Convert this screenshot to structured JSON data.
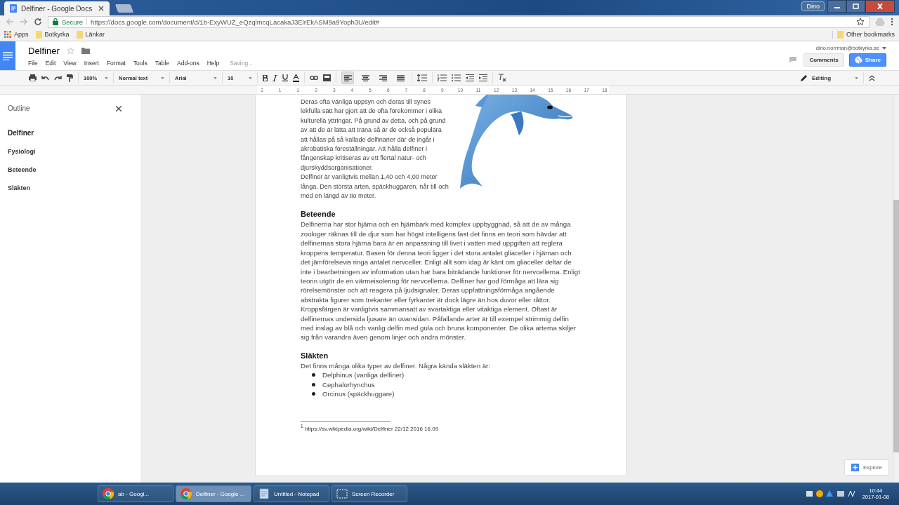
{
  "browser": {
    "tab_title": "Delfiner - Google Docs",
    "secure_label": "Secure",
    "url": "https://docs.google.com/document/d/1b-ExyWUZ_eQzqlmcqLacakaJ3ElrEkASM9a9Yoph3U/edit#",
    "bookmarks": [
      "Apps",
      "Botkyrka",
      "Länkar"
    ],
    "other_bookmarks": "Other bookmarks",
    "user_badge": "Dino"
  },
  "docs": {
    "title": "Delfiner",
    "menu": [
      "File",
      "Edit",
      "View",
      "Insert",
      "Format",
      "Tools",
      "Table",
      "Add-ons",
      "Help"
    ],
    "status": "Saving...",
    "account": "dino.norrman@botkyrka.se",
    "comments_button": "Comments",
    "share_button": "Share"
  },
  "toolbar": {
    "zoom": "100%",
    "style": "Normal text",
    "font": "Arial",
    "size": "10",
    "alignment": [
      {
        "selected": true
      },
      {
        "selected": false
      },
      {
        "selected": false
      },
      {
        "selected": false
      }
    ],
    "mode": "Editing"
  },
  "ruler": [
    "2",
    "1",
    "1",
    "2",
    "3",
    "4",
    "5",
    "6",
    "7",
    "8",
    "9",
    "10",
    "11",
    "12",
    "13",
    "14",
    "15",
    "16",
    "17",
    "18"
  ],
  "outline": {
    "title": "Outline",
    "items": [
      "Delfiner",
      "Fysiologi",
      "Beteende",
      "Släkten"
    ]
  },
  "document": {
    "intro": [
      "Deras ofta vänliga uppsyn och deras till synes lekfulla sätt har gjort att de ofta förekommer i olika kulturella yttringar. På grund av detta, och på grund av att de är lätta att träna så är de också populära att hållas på så kallade delfinarier där de ingår i akrobatiska föreställningar. Att hålla delfiner i fångenskap kritiseras av ett flertal natur- och djurskyddsorganisationer.",
      "Delfiner är vanligtvis mellan 1,40 och 4,00 meter långa. Den största arten, späckhuggaren, når till och med en längd av tio meter."
    ],
    "sections": [
      {
        "heading": "Beteende",
        "text": "Delfinerna har stor hjärna och en hjärnbark med komplex uppbyggnad, så att de av många zoologer räknas till de djur som har högst intelligens fast det finns en teori som hävdar att delfinernas stora hjärna bara är en anpassning till livet i vatten med uppgiften att reglera kroppens temperatur. Basen för denna teori ligger i det stora antalet gliaceller i hjärnan och det jämförelsevis ringa antalet nervceller. Enligt allt som idag är känt om gliaceller deltar de inte i bearbetningen av information utan har bara biträdande funktioner för nervcellerna. Enligt teorin utgör de en värmeisolering för nervcellerna. Delfiner har god förmåga att lära sig rörelsemönster och att reagera på ljudsignaler. Deras uppfattningsförmåga angående abstrakta figurer som trekanter eller fyrkanter är dock lägre än hos duvor eller råttor. Kroppsfärgen är vanligtvis sammansatt av svartaktiga eller vitaktiga element. Oftast är delfinernas undersida ljusare än ovansidan. Påfallande arter är till exempel strimmig delfin med inslag av blå och vanlig delfin med gula och bruna komponenter. De olika arterna skiljer sig från varandra även genom linjer och andra mönster."
      },
      {
        "heading": "Släkten",
        "text": "Det finns många olika typer av delfiner. Några kända släkten är:",
        "bullets": [
          "Delphinus (vanliga delfiner)",
          "Cephalorhynchus",
          "Orcinus (späckhuggare)"
        ]
      }
    ],
    "footnote": "$^{1}$ https://sv.wikipedia.org/wiki/Delfiner 22/12 2016 16.09"
  },
  "explore_button": "Explore",
  "taskbar": {
    "items": [
      {
        "label": "ab - Googl...",
        "kind": "chrome",
        "selected": false
      },
      {
        "label": "Delfiner - Google ...",
        "kind": "chrome",
        "selected": true
      },
      {
        "label": "Untitled - Notepad",
        "kind": "notepad",
        "selected": false
      },
      {
        "label": "Screen Recorder",
        "kind": "recorder",
        "selected": false
      }
    ],
    "time": "10:44",
    "date": "2017-01-08"
  }
}
